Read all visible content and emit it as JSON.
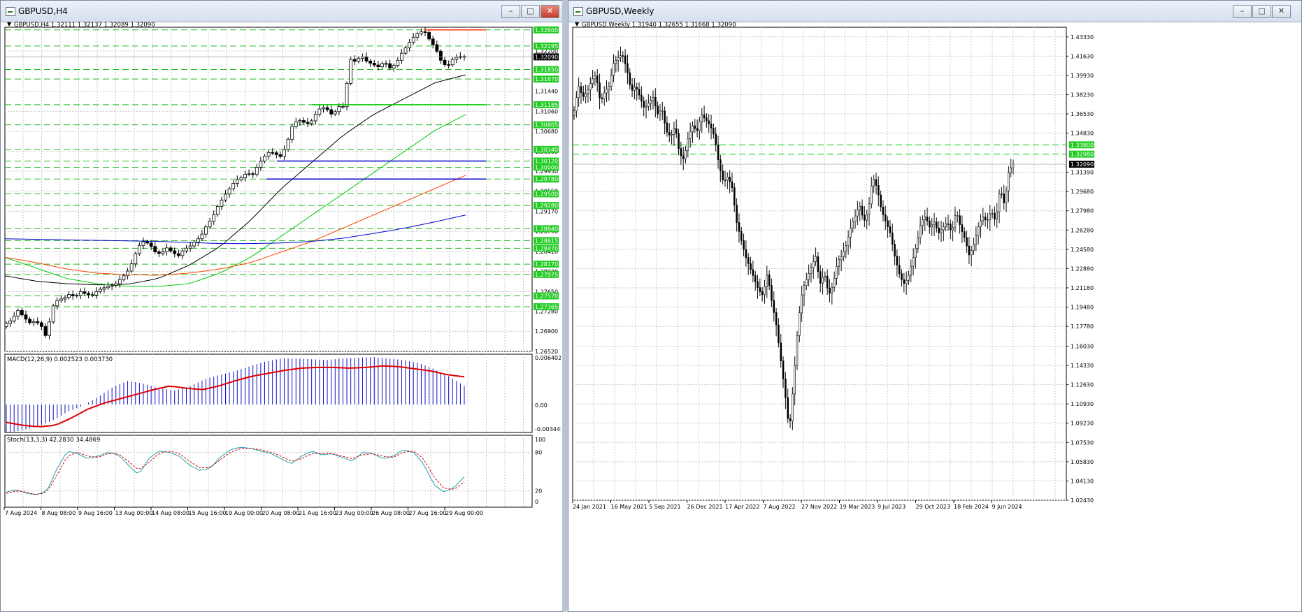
{
  "left_window": {
    "title": "GBPUSD,H4",
    "header": "GBPUSD,H4  1.32111 1.32137 1.32089 1.32090",
    "buttons": {
      "minimize": "–",
      "maximize": "□",
      "close": "✕"
    },
    "macd_label": "MACD(12,26,9) 0.002523 0.003730",
    "stoch_label": "Stoch(13,3,3) 42.2830 34.4869",
    "price_ticks": [
      "1.32200",
      "1.31440",
      "1.31060",
      "1.30680",
      "1.30300",
      "1.29930",
      "1.29550",
      "1.29170",
      "1.28790",
      "1.28410",
      "1.28030",
      "1.27650",
      "1.27280",
      "1.26900",
      "1.26520"
    ],
    "level_labels": [
      "1.32600",
      "1.32295",
      "1.31850",
      "1.31670",
      "1.31185",
      "1.30805",
      "1.30340",
      "1.30120",
      "1.30000",
      "1.29780",
      "1.29500",
      "1.29280",
      "1.28840",
      "1.28615",
      "1.28470",
      "1.28170",
      "1.27975",
      "1.27570",
      "1.27365"
    ],
    "current_price": "1.32090",
    "macd_ticks": [
      "0.006402",
      "0.00",
      "-0.003445"
    ],
    "stoch_ticks": [
      "100",
      "80",
      "20",
      "0"
    ],
    "time_labels": [
      "7 Aug 2024",
      "8 Aug 08:00",
      "9 Aug 16:00",
      "13 Aug 00:00",
      "14 Aug 08:00",
      "15 Aug 16:00",
      "19 Aug 00:00",
      "20 Aug 08:00",
      "21 Aug 16:00",
      "23 Aug 00:00",
      "26 Aug 08:00",
      "27 Aug 16:00",
      "29 Aug 00:00"
    ]
  },
  "right_window": {
    "title": "GBPUSD,Weekly",
    "header": "GBPUSD,Weekly  1.31940 1.32655 1.31668 1.32090",
    "buttons": {
      "minimize": "–",
      "maximize": "□",
      "close": "✕"
    },
    "price_ticks": [
      "1.43330",
      "1.41630",
      "1.39930",
      "1.38230",
      "1.36530",
      "1.34830",
      "1.31390",
      "1.29680",
      "1.27980",
      "1.26280",
      "1.24580",
      "1.22880",
      "1.21180",
      "1.19480",
      "1.17780",
      "1.16030",
      "1.14330",
      "1.12630",
      "1.10930",
      "1.09230",
      "1.07530",
      "1.05830",
      "1.04130",
      "1.02430"
    ],
    "level_labels": [
      "1.33800",
      "1.32980"
    ],
    "current_price": "1.32090",
    "time_labels": [
      "24 Jan 2021",
      "16 May 2021",
      "5 Sep 2021",
      "26 Dec 2021",
      "17 Apr 2022",
      "7 Aug 2022",
      "27 Nov 2022",
      "19 Mar 2023",
      "9 Jul 2023",
      "29 Oct 2023",
      "18 Feb 2024",
      "9 Jun 2024"
    ]
  },
  "chart_data": [
    {
      "type": "candlestick",
      "symbol": "GBPUSD",
      "timeframe": "H4",
      "ylim": [
        1.2652,
        1.3265
      ],
      "ohlc_last": {
        "open": 1.32111,
        "high": 1.32137,
        "low": 1.32089,
        "close": 1.3209
      },
      "close_path": [
        1.2705,
        1.2712,
        1.273,
        1.2718,
        1.2706,
        1.2709,
        1.2703,
        1.2678,
        1.2735,
        1.275,
        1.2752,
        1.276,
        1.2755,
        1.2765,
        1.276,
        1.2758,
        1.2768,
        1.2772,
        1.2776,
        1.2778,
        1.279,
        1.28,
        1.282,
        1.285,
        1.286,
        1.2855,
        1.284,
        1.2836,
        1.2848,
        1.284,
        1.2832,
        1.2845,
        1.285,
        1.286,
        1.287,
        1.289,
        1.2905,
        1.2928,
        1.2945,
        1.296,
        1.2975,
        1.298,
        1.299,
        1.2985,
        1.3005,
        1.302,
        1.303,
        1.3025,
        1.302,
        1.3045,
        1.308,
        1.309,
        1.3085,
        1.3082,
        1.31,
        1.3115,
        1.311,
        1.3098,
        1.3115,
        1.3115,
        1.3205,
        1.32,
        1.3212,
        1.32,
        1.3195,
        1.319,
        1.32,
        1.3188,
        1.3195,
        1.3215,
        1.323,
        1.3245,
        1.3255,
        1.3258,
        1.324,
        1.3225,
        1.32,
        1.319,
        1.3205,
        1.321,
        1.3209
      ],
      "horizontal_levels": [
        {
          "price": 1.326,
          "color": "#ff3300",
          "style": "solid"
        },
        {
          "price": 1.31185,
          "color": "#00cc00",
          "style": "solid"
        },
        {
          "price": 1.3012,
          "color": "#0000cc",
          "style": "solid"
        },
        {
          "price": 1.2978,
          "color": "#0000cc",
          "style": "solid"
        }
      ],
      "moving_averages": [
        {
          "name": "",
          "color": "#000000",
          "values": [
            1.2795,
            1.2785,
            1.278,
            1.2778,
            1.2779,
            1.279,
            1.2815,
            1.285,
            1.29,
            1.296,
            1.301,
            1.306,
            1.31,
            1.313,
            1.316,
            1.3175
          ]
        },
        {
          "name": "",
          "color": "#00cc00",
          "values": [
            1.283,
            1.281,
            1.279,
            1.278,
            1.2775,
            1.2775,
            1.278,
            1.28,
            1.283,
            1.287,
            1.291,
            1.295,
            1.299,
            1.303,
            1.307,
            1.31
          ]
        },
        {
          "name": "",
          "color": "#ff4400",
          "values": [
            1.283,
            1.282,
            1.2808,
            1.28,
            1.2797,
            1.2796,
            1.28,
            1.2808,
            1.282,
            1.284,
            1.286,
            1.2885,
            1.291,
            1.2935,
            1.296,
            1.2985
          ]
        },
        {
          "name": "",
          "color": "#0000cc",
          "values": [
            1.2865,
            1.2864,
            1.2863,
            1.2862,
            1.2861,
            1.286,
            1.2858,
            1.2856,
            1.2856,
            1.2857,
            1.286,
            1.2866,
            1.2875,
            1.2885,
            1.2897,
            1.291
          ]
        }
      ],
      "macd": {
        "ylim": [
          -0.003445,
          0.006402
        ],
        "value": 0.002523,
        "signal": 0.00373
      },
      "stochastic": {
        "params": "13,3,3",
        "main": 42.283,
        "signal": 34.4869,
        "levels": [
          20,
          80
        ]
      }
    },
    {
      "type": "candlestick",
      "symbol": "GBPUSD",
      "timeframe": "Weekly",
      "ylim": [
        1.0243,
        1.4418
      ],
      "ohlc_last": {
        "open": 1.3194,
        "high": 1.32655,
        "low": 1.31668,
        "close": 1.3209
      },
      "close_path": [
        1.368,
        1.39,
        1.38,
        1.385,
        1.395,
        1.4,
        1.375,
        1.385,
        1.39,
        1.41,
        1.415,
        1.418,
        1.405,
        1.385,
        1.39,
        1.38,
        1.37,
        1.375,
        1.38,
        1.365,
        1.37,
        1.35,
        1.345,
        1.355,
        1.33,
        1.325,
        1.345,
        1.355,
        1.35,
        1.365,
        1.36,
        1.355,
        1.345,
        1.32,
        1.305,
        1.31,
        1.3,
        1.27,
        1.255,
        1.24,
        1.23,
        1.22,
        1.21,
        1.205,
        1.225,
        1.2,
        1.18,
        1.15,
        1.12,
        1.085,
        1.13,
        1.18,
        1.21,
        1.22,
        1.23,
        1.24,
        1.215,
        1.225,
        1.205,
        1.215,
        1.235,
        1.24,
        1.25,
        1.265,
        1.275,
        1.285,
        1.27,
        1.28,
        1.31,
        1.3,
        1.28,
        1.27,
        1.26,
        1.24,
        1.225,
        1.215,
        1.22,
        1.235,
        1.25,
        1.27,
        1.275,
        1.265,
        1.27,
        1.26,
        1.265,
        1.27,
        1.26,
        1.28,
        1.265,
        1.255,
        1.24,
        1.25,
        1.265,
        1.275,
        1.27,
        1.28,
        1.27,
        1.3,
        1.285,
        1.315,
        1.3209
      ],
      "horizontal_levels": [
        {
          "price": 1.338,
          "color": "#00cc00",
          "style": "dashed"
        },
        {
          "price": 1.3298,
          "color": "#00cc00",
          "style": "dashed"
        }
      ]
    }
  ]
}
